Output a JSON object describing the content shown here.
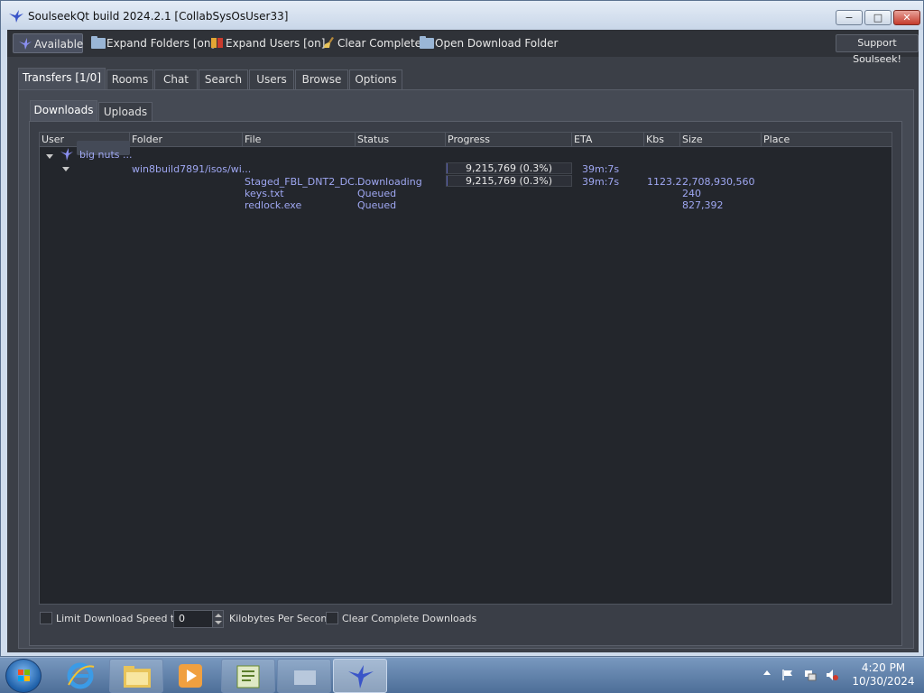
{
  "window": {
    "title": "SoulseekQt build 2024.2.1 [CollabSysOsUser33]",
    "controls": {
      "minimize": "−",
      "maximize": "□",
      "close": "✕"
    }
  },
  "toolbar": {
    "available": "Available",
    "expand_folders": "Expand Folders [on]",
    "expand_users": "Expand Users [on]",
    "clear_complete": "Clear Complete",
    "open_download_folder": "Open Download Folder",
    "support": "Support Soulseek!"
  },
  "tabs": [
    {
      "label": "Transfers [1/0]",
      "active": true
    },
    {
      "label": "Rooms",
      "active": false
    },
    {
      "label": "Chat",
      "active": false
    },
    {
      "label": "Search",
      "active": false
    },
    {
      "label": "Users",
      "active": false
    },
    {
      "label": "Browse",
      "active": false
    },
    {
      "label": "Options",
      "active": false
    }
  ],
  "subtabs": [
    {
      "label": "Downloads",
      "active": true
    },
    {
      "label": "Uploads",
      "active": false
    }
  ],
  "table": {
    "columns": [
      "User",
      "Folder",
      "File",
      "Status",
      "Progress",
      "ETA",
      "Kbs",
      "Size",
      "Place"
    ],
    "user": "big nuts ...",
    "folder": "win8build7891/isos/wi...",
    "folder_progress": {
      "text": "9,215,769 (0.3%)",
      "fraction": 0.003
    },
    "folder_eta": "39m:7s",
    "files": [
      {
        "file": "Staged_FBL_DNT2_DC...",
        "status": "Downloading",
        "progress": "9,215,769 (0.3%)",
        "progress_fraction": 0.003,
        "eta": "39m:7s",
        "kbs": "1123.2",
        "size": "2,708,930,560"
      },
      {
        "file": "keys.txt",
        "status": "Queued",
        "progress": "",
        "eta": "",
        "kbs": "",
        "size": "240"
      },
      {
        "file": "redlock.exe",
        "status": "Queued",
        "progress": "",
        "eta": "",
        "kbs": "",
        "size": "827,392"
      }
    ]
  },
  "bottom": {
    "limit_label": "Limit Download Speed to",
    "speed_value": "0",
    "unit_label": "Kilobytes Per Second",
    "clear_label": "Clear Complete Downloads"
  },
  "taskbar": {
    "time": "4:20 PM",
    "date": "10/30/2024"
  },
  "colors": {
    "background": "#3b3f47",
    "text_accent": "#9fa7f2",
    "toolbar": "#2f3238"
  }
}
